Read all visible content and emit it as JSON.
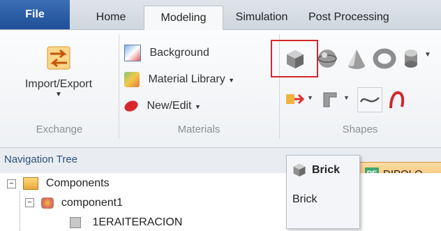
{
  "tabs": [
    {
      "label": "File"
    },
    {
      "label": "Home"
    },
    {
      "label": "Modeling"
    },
    {
      "label": "Simulation"
    },
    {
      "label": "Post Processing"
    }
  ],
  "exchange": {
    "import_export": "Import/Export",
    "group": "Exchange"
  },
  "materials": {
    "background": "Background",
    "library": "Material Library",
    "new_edit": "New/Edit",
    "group": "Materials"
  },
  "shapes": {
    "group": "Shapes"
  },
  "nav": {
    "title": "Navigation Tree"
  },
  "tree": {
    "components": "Components",
    "component1": "component1",
    "item": "1ERAITERACION"
  },
  "popup": {
    "title": "Brick",
    "item": "Brick"
  },
  "doc_tab": {
    "label": "DIPOLO"
  },
  "colors": {
    "file_tab": "#2a5ea8",
    "highlight": "#d4262b",
    "doc_tab": "#f6b761"
  }
}
